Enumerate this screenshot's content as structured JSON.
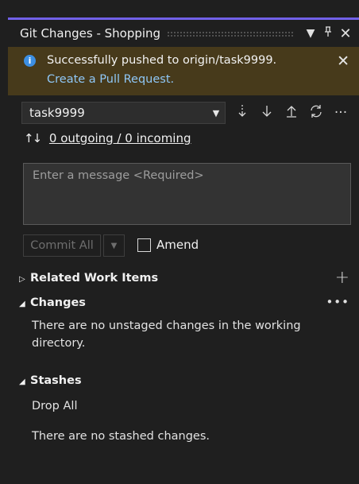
{
  "titlebar": {
    "title": "Git Changes - Shopping",
    "icons": [
      "chevron-down-icon",
      "pin-icon",
      "close-icon"
    ],
    "accent_color": "#7160e8"
  },
  "banner": {
    "message": "Successfully pushed to origin/task9999.",
    "link": "Create a Pull Request.",
    "bg_color": "#473a1b",
    "link_color": "#8fc7f6"
  },
  "branch": {
    "name": "task9999",
    "actions": [
      "fetch-icon",
      "pull-icon",
      "push-icon",
      "sync-icon",
      "more-icon"
    ]
  },
  "sync": {
    "link": "0 outgoing / 0 incoming"
  },
  "commit_message": {
    "placeholder": "Enter a message <Required>"
  },
  "commit": {
    "button_label": "Commit All",
    "amend_label": "Amend"
  },
  "sections": {
    "related": {
      "title": "Related Work Items"
    },
    "changes": {
      "title": "Changes",
      "empty_text": "There are no unstaged changes in the working directory."
    },
    "stashes": {
      "title": "Stashes",
      "drop_all": "Drop All",
      "empty_text": "There are no stashed changes."
    }
  }
}
